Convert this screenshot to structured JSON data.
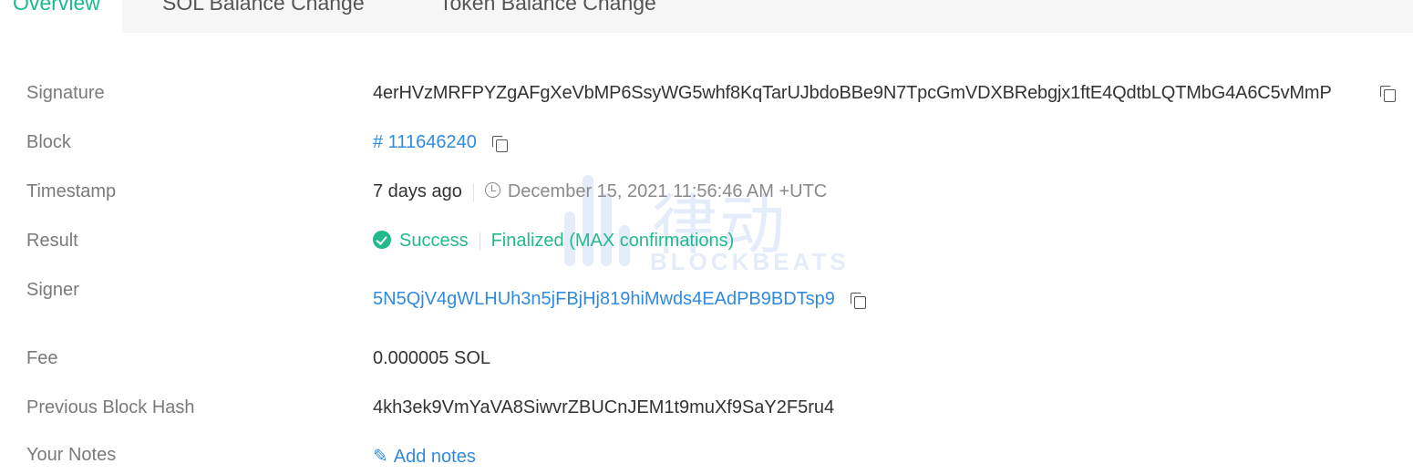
{
  "tabs": [
    {
      "label": "Overview",
      "active": true
    },
    {
      "label": "SOL Balance Change",
      "active": false
    },
    {
      "label": "Token Balance Change",
      "active": false
    }
  ],
  "rows": {
    "signature": {
      "label": "Signature",
      "value": "4erHVzMRFPYZgAFgXeVbMP6SsyWG5whf8KqTarUJbdoBBe9N7TpcGmVDXBRebgjx1ftE4QdtbLQTMbG4A6C5vMmP"
    },
    "block": {
      "label": "Block",
      "value": "# 111646240"
    },
    "timestamp": {
      "label": "Timestamp",
      "relative": "7 days ago",
      "absolute": "December 15, 2021 11:56:46 AM +UTC"
    },
    "result": {
      "label": "Result",
      "status": "Success",
      "finality": "Finalized (MAX confirmations)"
    },
    "signer": {
      "label": "Signer",
      "value": "5N5QjV4gWLHUh3n5jFBjHj819hiMwds4EAdPB9BDTsp9"
    },
    "fee": {
      "label": "Fee",
      "value": "0.000005 SOL"
    },
    "previous_block_hash": {
      "label": "Previous Block Hash",
      "value": "4kh3ek9VmYaVA8SiwvrZBUCnJEM1t9muXf9SaY2F5ru4"
    },
    "your_notes": {
      "label": "Your Notes",
      "action": "Add notes"
    }
  },
  "watermark": {
    "glyphs": "律动",
    "text": "BLOCKBEATS"
  },
  "colors": {
    "accent_green": "#22b98c",
    "link_blue": "#2f8be0",
    "label_gray": "#7a7a7a"
  }
}
